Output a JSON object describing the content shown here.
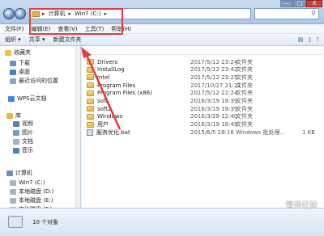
{
  "window": {
    "nav_back_icon": "arrow-left-icon",
    "nav_forward_icon": "arrow-right-icon",
    "controls": {
      "minimize": "—",
      "maximize": "□",
      "close": "X"
    }
  },
  "address": {
    "segments": [
      "计算机",
      "Win7 (C:)"
    ],
    "separator": "▸"
  },
  "search": {
    "icon": "search-icon",
    "glyph": "⚲"
  },
  "menu": [
    "文件(F)",
    "编辑(E)",
    "查看(V)",
    "工具(T)",
    "帮助(H)"
  ],
  "toolbar": {
    "organize": "组织 ▾",
    "share": "共享 ▾",
    "new_folder": "新建文件夹"
  },
  "sidebar": [
    {
      "label": "收藏夹",
      "icon": "star-icon",
      "color": "#f2c230"
    },
    {
      "label": "下载",
      "icon": "download-folder-icon",
      "color": "#6b8fbf"
    },
    {
      "label": "桌面",
      "icon": "desktop-icon",
      "color": "#4a7fc0"
    },
    {
      "label": "最近访问的位置",
      "icon": "recent-places-icon",
      "color": "#8aa4c8"
    },
    {
      "label": "WPS云文档",
      "icon": "cloud-icon",
      "color": "#3f88d8"
    },
    {
      "label": "库",
      "icon": "library-icon",
      "color": "#e3b845"
    },
    {
      "label": "视频",
      "icon": "video-icon",
      "color": "#5f7fa8"
    },
    {
      "label": "图片",
      "icon": "picture-icon",
      "color": "#6aa0d0"
    },
    {
      "label": "文档",
      "icon": "document-icon",
      "color": "#9fb0c7"
    },
    {
      "label": "音乐",
      "icon": "music-icon",
      "color": "#4a7fc0"
    },
    {
      "label": "计算机",
      "icon": "computer-icon",
      "color": "#6f8fb5"
    },
    {
      "label": "Win7 (C:)",
      "icon": "drive-icon",
      "color": "#a9b4c2"
    },
    {
      "label": "本地磁盘 (D:)",
      "icon": "drive-icon",
      "color": "#a9b4c2"
    },
    {
      "label": "本地磁盘 (E:)",
      "icon": "drive-icon",
      "color": "#a9b4c2"
    },
    {
      "label": "本地磁盘 (F:)",
      "icon": "drive-icon",
      "color": "#a9b4c2"
    }
  ],
  "files": [
    {
      "name": "Drivers",
      "date": "2017/5/12 23:24",
      "type": "文件夹",
      "size": "",
      "kind": "folder"
    },
    {
      "name": "InstallLog",
      "date": "2017/5/12 23:42",
      "type": "文件夹",
      "size": "",
      "kind": "folder"
    },
    {
      "name": "Intel",
      "date": "2017/5/12 23:25",
      "type": "文件夹",
      "size": "",
      "kind": "folder"
    },
    {
      "name": "Program Files",
      "date": "2017/10/27 21:21",
      "type": "文件夹",
      "size": "",
      "kind": "folder"
    },
    {
      "name": "Program Files (x86)",
      "date": "2017/5/12 22:24",
      "type": "文件夹",
      "size": "",
      "kind": "folder"
    },
    {
      "name": "soft",
      "date": "2016/3/19 18:39",
      "type": "文件夹",
      "size": "",
      "kind": "folder"
    },
    {
      "name": "soft2",
      "date": "2016/3/19 18:39",
      "type": "文件夹",
      "size": "",
      "kind": "folder"
    },
    {
      "name": "Windows",
      "date": "2016/3/28 12:40",
      "type": "文件夹",
      "size": "",
      "kind": "folder"
    },
    {
      "name": "用户",
      "date": "2016/3/19 18:49",
      "type": "文件夹",
      "size": "",
      "kind": "folder"
    },
    {
      "name": "服务优化.bat",
      "date": "2015/6/5 18:16",
      "type": "Windows 批处理...",
      "size": "1 KB",
      "kind": "bat"
    }
  ],
  "status": {
    "count": "10 个对象"
  },
  "watermark": "懂得经验",
  "annotation_color": "#e53b3b"
}
